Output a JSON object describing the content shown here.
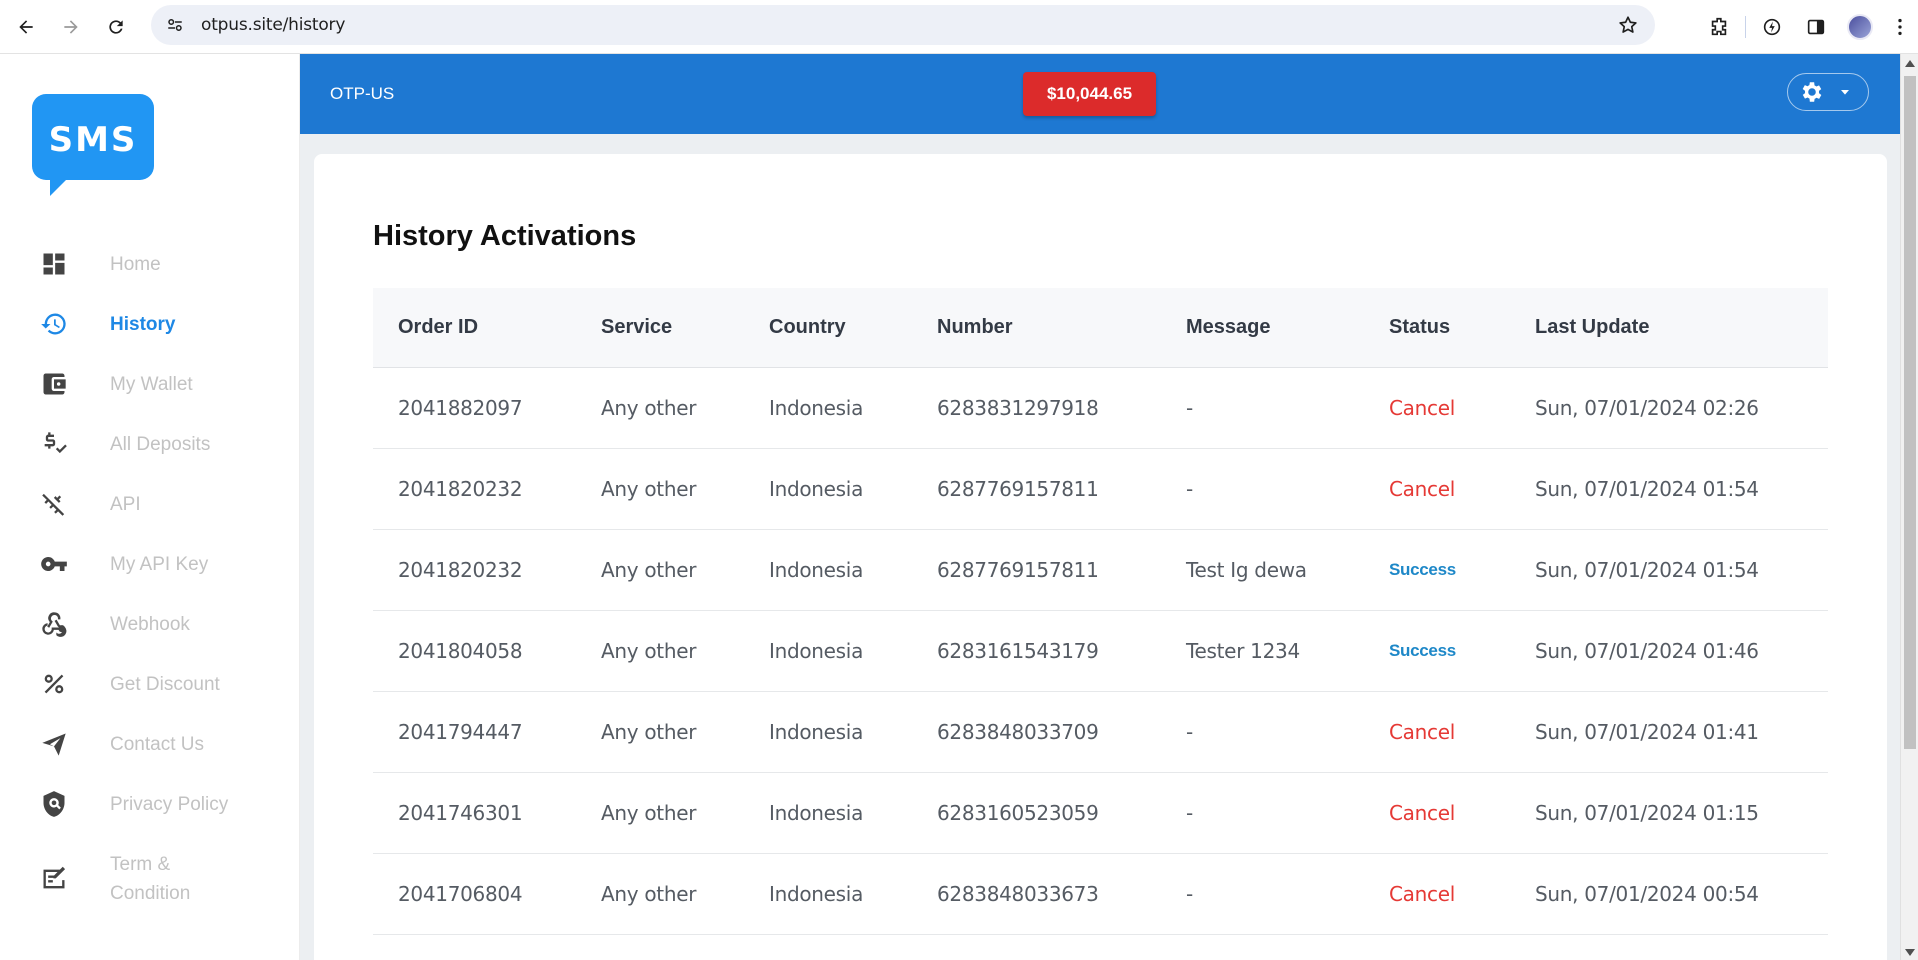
{
  "browser": {
    "url": "otpus.site/history",
    "icons": [
      "back-icon",
      "forward-icon",
      "reload-icon",
      "site-settings-icon",
      "bookmark-star-icon",
      "extensions-icon",
      "performance-icon",
      "side-panel-icon",
      "profile-avatar",
      "more-menu-icon"
    ]
  },
  "sidebar": {
    "logo_text": "SMS",
    "items": [
      {
        "label": "Home",
        "icon": "dashboard-icon",
        "active": false
      },
      {
        "label": "History",
        "icon": "history-icon",
        "active": true
      },
      {
        "label": "My Wallet",
        "icon": "wallet-icon",
        "active": false
      },
      {
        "label": "All Deposits",
        "icon": "deposit-icon",
        "active": false
      },
      {
        "label": "API",
        "icon": "api-icon",
        "active": false
      },
      {
        "label": "My API Key",
        "icon": "key-icon",
        "active": false
      },
      {
        "label": "Webhook",
        "icon": "webhook-icon",
        "active": false
      },
      {
        "label": "Get Discount",
        "icon": "percent-icon",
        "active": false
      },
      {
        "label": "Contact Us",
        "icon": "send-icon",
        "active": false
      },
      {
        "label": "Privacy Policy",
        "icon": "shield-icon",
        "active": false
      },
      {
        "label": "Term &\nCondition",
        "icon": "terms-icon",
        "active": false
      }
    ]
  },
  "header": {
    "brand": "OTP-US",
    "balance": "$10,044.65",
    "settings_icon": "gear-icon",
    "settings_caret": "caret-down-icon"
  },
  "page": {
    "title": "History Activations"
  },
  "table": {
    "columns": [
      "Order ID",
      "Service",
      "Country",
      "Number",
      "Message",
      "Status",
      "Last Update"
    ],
    "rows": [
      {
        "order_id": "2041882097",
        "service": "Any other",
        "country": "Indonesia",
        "number": "6283831297918",
        "message": "-",
        "status": "Cancel",
        "last_update": "Sun, 07/01/2024 02:26"
      },
      {
        "order_id": "2041820232",
        "service": "Any other",
        "country": "Indonesia",
        "number": "6287769157811",
        "message": "-",
        "status": "Cancel",
        "last_update": "Sun, 07/01/2024 01:54"
      },
      {
        "order_id": "2041820232",
        "service": "Any other",
        "country": "Indonesia",
        "number": "6287769157811",
        "message": "Test Ig dewa",
        "status": "Success",
        "last_update": "Sun, 07/01/2024 01:54"
      },
      {
        "order_id": "2041804058",
        "service": "Any other",
        "country": "Indonesia",
        "number": "6283161543179",
        "message": "Tester 1234",
        "status": "Success",
        "last_update": "Sun, 07/01/2024 01:46"
      },
      {
        "order_id": "2041794447",
        "service": "Any other",
        "country": "Indonesia",
        "number": "6283848033709",
        "message": "-",
        "status": "Cancel",
        "last_update": "Sun, 07/01/2024 01:41"
      },
      {
        "order_id": "2041746301",
        "service": "Any other",
        "country": "Indonesia",
        "number": "6283160523059",
        "message": "-",
        "status": "Cancel",
        "last_update": "Sun, 07/01/2024 01:15"
      },
      {
        "order_id": "2041706804",
        "service": "Any other",
        "country": "Indonesia",
        "number": "6283848033673",
        "message": "-",
        "status": "Cancel",
        "last_update": "Sun, 07/01/2024 00:54"
      }
    ]
  },
  "colors": {
    "header_blue": "#1e78d2",
    "balance_red": "#dc2b2b",
    "active_blue": "#1e88e5",
    "cancel_red": "#e53935",
    "success_blue": "#1e88c8"
  }
}
